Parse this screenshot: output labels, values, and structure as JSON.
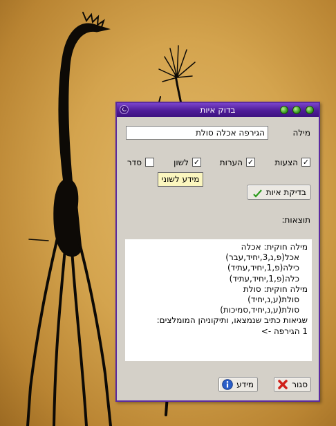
{
  "window": {
    "title": "בדוק איות"
  },
  "word_field": {
    "label": "מילה",
    "value": "הגירפה אכלה סולת"
  },
  "options": [
    {
      "label": "הצעות",
      "checked": true
    },
    {
      "label": "הערות",
      "checked": true
    },
    {
      "label": "לשון",
      "checked": true
    },
    {
      "label": "סדר",
      "checked": false
    }
  ],
  "tooltip": "מידע לשוני",
  "check_button": {
    "label": "בדיקת איות",
    "icon": "abc-check-icon"
  },
  "results": {
    "label": "תוצאות:",
    "lines": [
      {
        "text": "מילה חוקית: אכלה",
        "indent": false
      },
      {
        "text": "אכל(פ,נ,3,יחיד,עבר)",
        "indent": true
      },
      {
        "text": "כילה(פ,1,יחיד,עתיד)",
        "indent": true
      },
      {
        "text": "כלה(פ,1,יחיד,עתיד)",
        "indent": true
      },
      {
        "text": "מילה חוקית: סולת",
        "indent": false
      },
      {
        "text": "סולת(ע,נ,יחיד)",
        "indent": true
      },
      {
        "text": "סולת(ע,נ,יחיד,סמיכות)",
        "indent": true
      },
      {
        "text": "שגיאות כתיב שנמצאו, ותיקוניהן המומלצים:",
        "indent": false
      },
      {
        "text": "",
        "indent": false
      },
      {
        "text": "1 הגירפה ->",
        "indent": false
      }
    ]
  },
  "close_button": {
    "label": "סגור",
    "icon": "red-x-icon"
  },
  "info_button": {
    "label": "מידע",
    "icon": "info-icon"
  },
  "colors": {
    "titlebar": "#4e1c98",
    "window_bg": "#d4d0c8",
    "tooltip_bg": "#fbf6bf"
  }
}
